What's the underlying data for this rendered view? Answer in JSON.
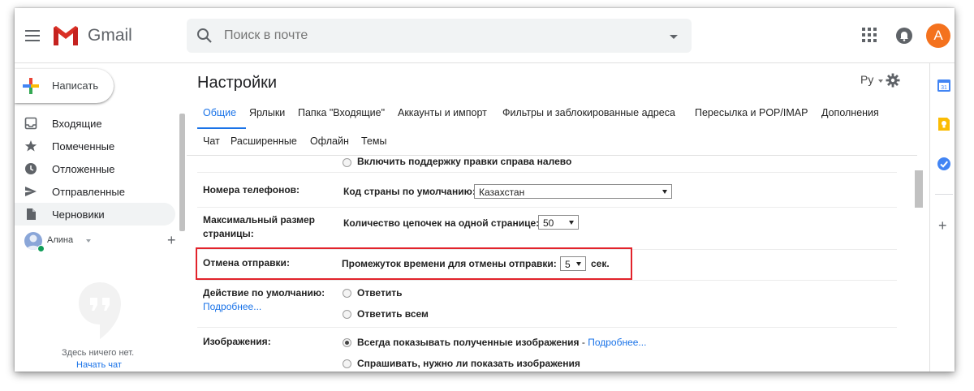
{
  "app": {
    "brand": "Gmail",
    "avatar_letter": "A"
  },
  "search": {
    "placeholder": "Поиск в почте"
  },
  "compose": {
    "label": "Написать"
  },
  "nav": {
    "items": [
      {
        "label": "Входящие",
        "icon": "inbox-icon"
      },
      {
        "label": "Помеченные",
        "icon": "star-icon"
      },
      {
        "label": "Отложенные",
        "icon": "clock-icon"
      },
      {
        "label": "Отправленные",
        "icon": "send-icon"
      },
      {
        "label": "Черновики",
        "icon": "draft-icon",
        "active": true
      }
    ]
  },
  "hangouts": {
    "user": "Алина",
    "empty_text": "Здесь ничего нет.",
    "start_chat": "Начать чат"
  },
  "settings": {
    "title": "Настройки",
    "language": "Ру",
    "tabs_row1": [
      "Общие",
      "Ярлыки",
      "Папка \"Входящие\"",
      "Аккаунты и импорт",
      "Фильтры и заблокированные адреса",
      "Пересылка и POP/IMAP",
      "Дополнения"
    ],
    "tabs_row2": [
      "Чат",
      "Расширенные",
      "Офлайн",
      "Темы"
    ],
    "rtl_option": "Включить поддержку правки справа налево",
    "phone": {
      "label": "Номера телефонов:",
      "field_label": "Код страны по умолчанию:",
      "value": "Казахстан"
    },
    "page_size": {
      "label": "Максимальный размер страницы:",
      "field_label": "Количество цепочек на одной странице:",
      "value": "50"
    },
    "undo_send": {
      "label": "Отмена отправки:",
      "field_label": "Промежуток времени для отмены отправки:",
      "value": "5",
      "unit": "сек."
    },
    "default_action": {
      "label": "Действие по умолчанию:",
      "more_link": "Подробнее...",
      "options": [
        "Ответить",
        "Ответить всем"
      ],
      "selected": null
    },
    "images": {
      "label": "Изображения:",
      "options": [
        "Всегда показывать полученные изображения",
        "Спрашивать, нужно ли показать изображения"
      ],
      "separator": " - ",
      "more_link": "Подробнее...",
      "selected": 0
    }
  },
  "colors": {
    "accent": "#1a73e8",
    "highlight": "#e2232b",
    "avatar": "#f4721e"
  }
}
